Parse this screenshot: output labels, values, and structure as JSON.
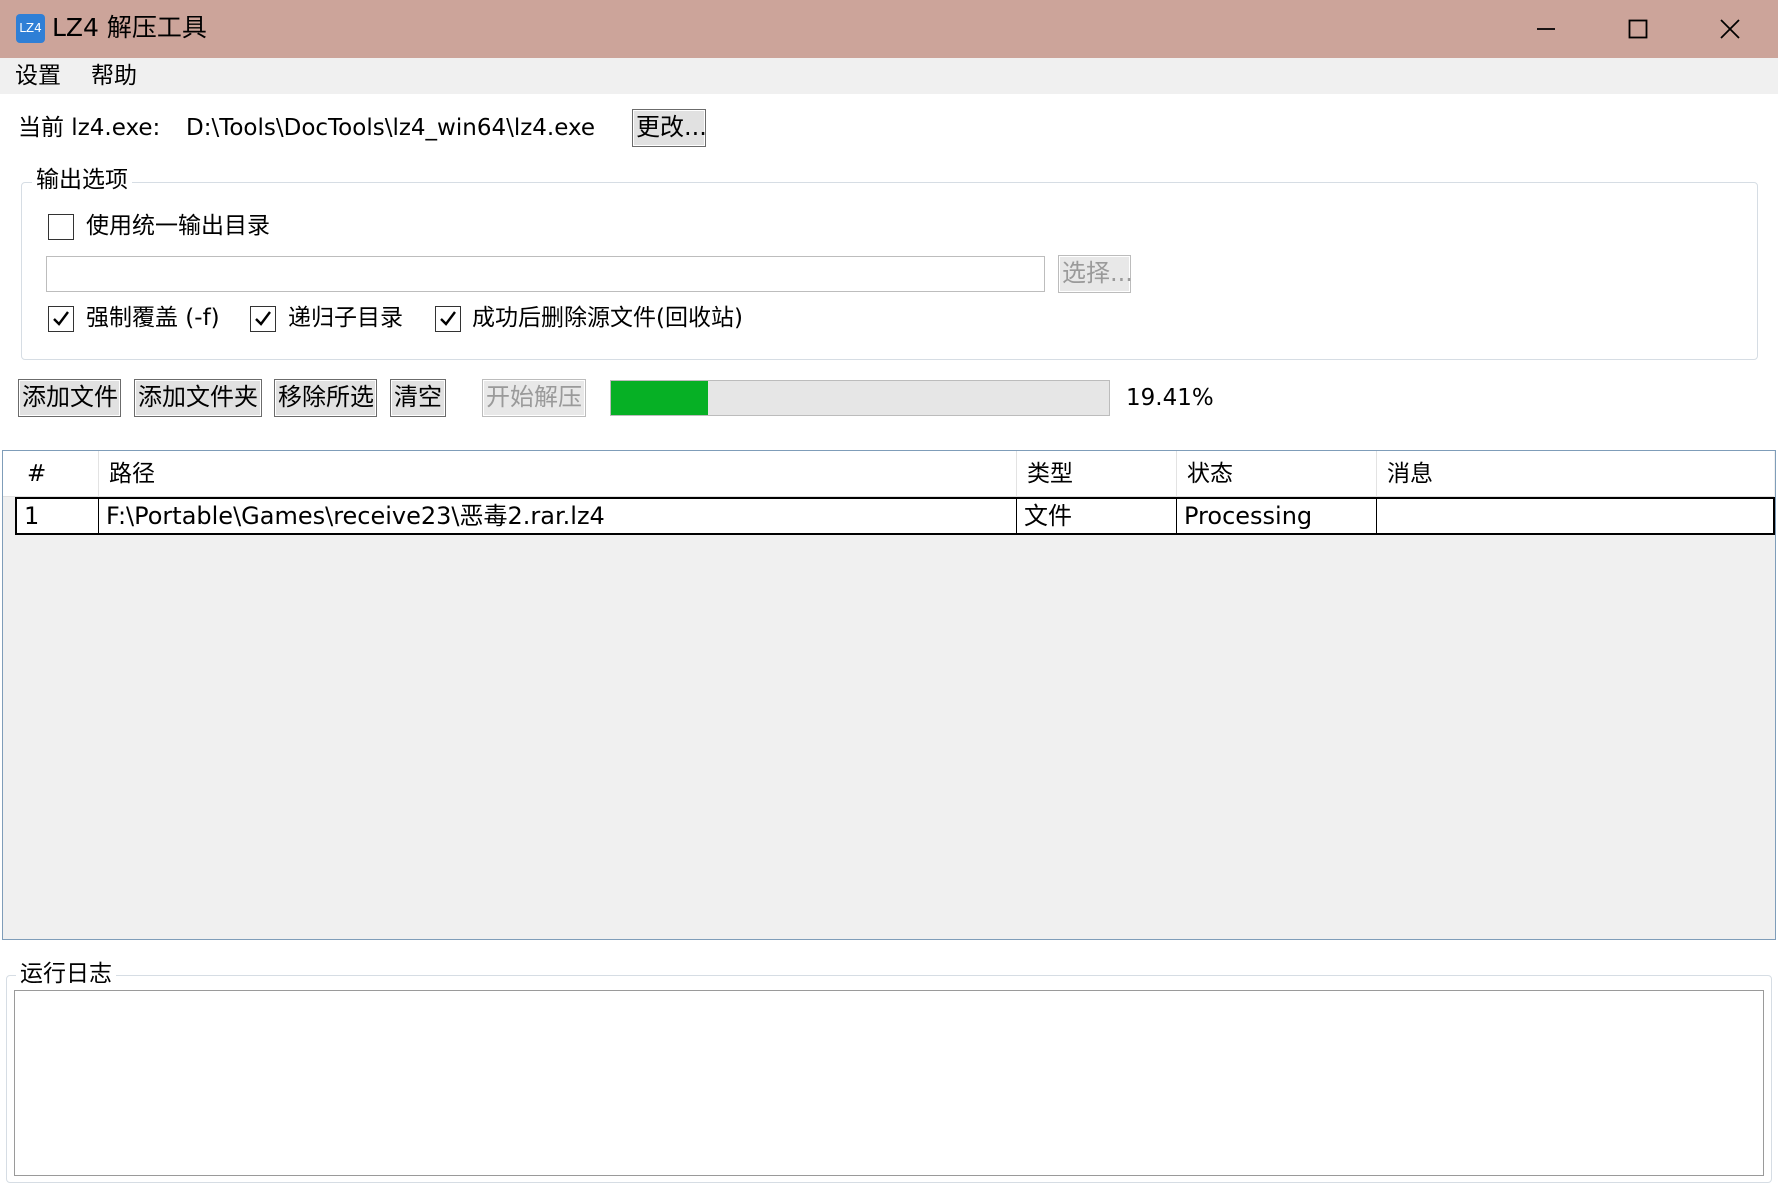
{
  "window": {
    "icon_text": "LZ4",
    "title": "LZ4 解压工具"
  },
  "menu": {
    "items": [
      {
        "label": "设置"
      },
      {
        "label": "帮助"
      }
    ]
  },
  "exe": {
    "label": "当前 lz4.exe:",
    "path": "D:\\Tools\\DocTools\\lz4_win64\\lz4.exe",
    "change_button": "更改..."
  },
  "output_options": {
    "caption": "输出选项",
    "unified_dir": {
      "label": "使用统一输出目录",
      "checked": false
    },
    "dir_value": "",
    "choose_button": "选择...",
    "force": {
      "label": "强制覆盖 (-f)",
      "checked": true
    },
    "recursive": {
      "label": "递归子目录",
      "checked": true
    },
    "delete_source": {
      "label": "成功后删除源文件(回收站)",
      "checked": true
    }
  },
  "toolbar": {
    "add_file": "添加文件",
    "add_folder": "添加文件夹",
    "remove_selected": "移除所选",
    "clear": "清空",
    "start": "开始解压"
  },
  "progress": {
    "value": 19.41,
    "text": "19.41%",
    "fill_color": "#06b025"
  },
  "list": {
    "columns": [
      "#",
      "路径",
      "类型",
      "状态",
      "消息"
    ],
    "rows": [
      {
        "index": "1",
        "path": "F:\\Portable\\Games\\receive23\\恶毒2.rar.lz4",
        "type": "文件",
        "status": "Processing",
        "message": ""
      }
    ]
  },
  "log": {
    "caption": "运行日志",
    "content": ""
  }
}
